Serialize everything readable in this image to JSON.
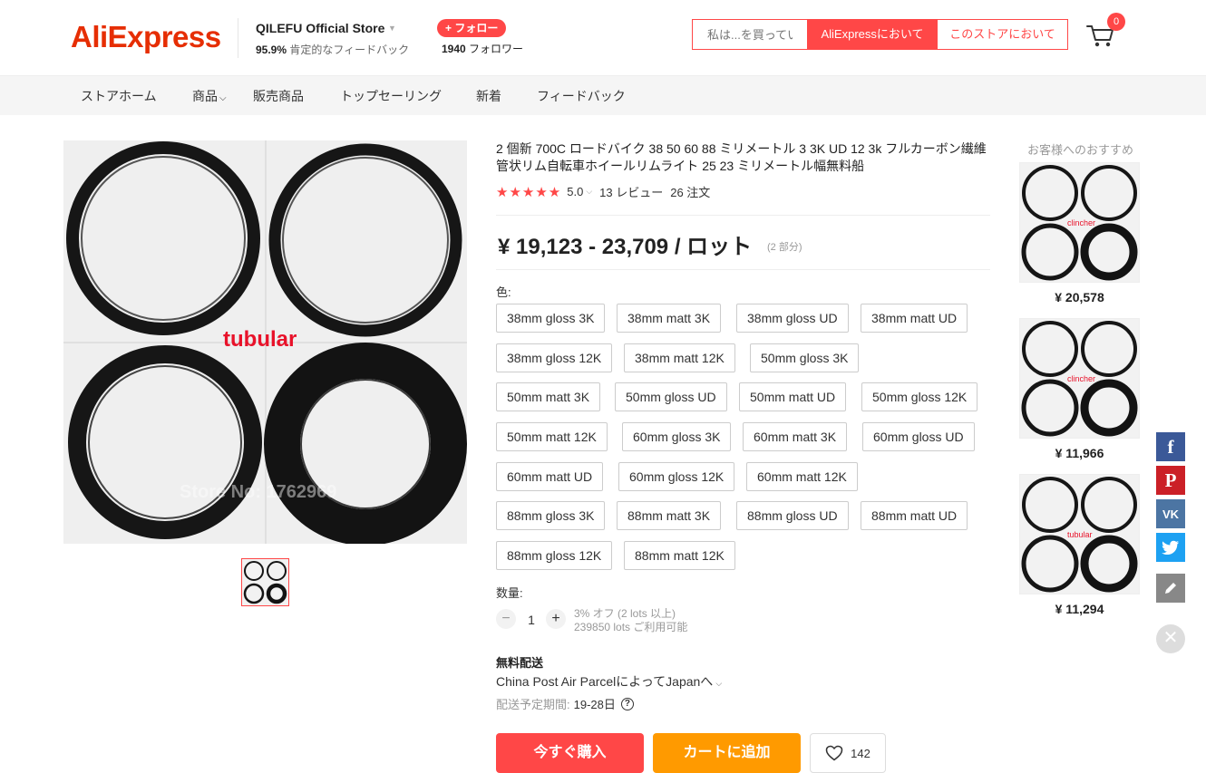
{
  "header": {
    "logo": "AliExpress",
    "store_name": "QILEFU Official Store",
    "feedback_pct": "95.9%",
    "feedback_label": "肯定的なフィードバック",
    "follow_label": "+ フォロー",
    "followers_count": "1940",
    "followers_label": "フォロワー",
    "search_placeholder": "私は...を買ってい",
    "search_ali_label": "AliExpressにおいて",
    "search_store_label": "このストアにおいて",
    "cart_count": "0"
  },
  "nav": [
    "ストアホーム",
    "商品",
    "販売商品",
    "トップセーリング",
    "新着",
    "フィードバック"
  ],
  "gallery": {
    "main_label": "tubular",
    "watermark": "Store No: 1762969"
  },
  "product": {
    "title": "2 個新 700C ロードバイク 38 50 60 88 ミリメートル 3 3K UD 12 3k フルカーボン繊維管状リム自転車ホイールリムライト 25 23 ミリメートル幅無料船",
    "rating": "5.0",
    "reviews": "13 レビュー",
    "orders": "26 注文",
    "price": "¥ 19,123 - 23,709 / ロット",
    "price_note": "(2 部分)",
    "color_label": "色:",
    "color_options": [
      "38mm gloss 3K",
      "38mm matt 3K",
      "38mm gloss UD",
      "38mm matt UD",
      "38mm gloss 12K",
      "38mm matt 12K",
      "50mm gloss 3K",
      "50mm matt 3K",
      "50mm gloss UD",
      "50mm matt UD",
      "50mm gloss 12K",
      "50mm matt 12K",
      "60mm gloss 3K",
      "60mm matt 3K",
      "60mm gloss UD",
      "60mm matt UD",
      "60mm gloss 12K",
      "60mm matt 12K",
      "88mm gloss 3K",
      "88mm matt 3K",
      "88mm gloss UD",
      "88mm matt UD",
      "88mm gloss 12K",
      "88mm matt 12K"
    ],
    "quantity_label": "数量:",
    "quantity": "1",
    "discount_note": "3% オフ (2 lots 以上)",
    "available_note": "239850 lots ご利用可能",
    "shipping_title": "無料配送",
    "shipping_method": "China Post Air ParcelによってJapanへ",
    "eta_label": "配送予定期間:",
    "eta_value": "19-28日",
    "buy_now": "今すぐ購入",
    "add_to_cart": "カートに追加",
    "wishlist_count": "142"
  },
  "recommendations": {
    "title": "お客様へのおすすめ",
    "items": [
      {
        "label": "clincher",
        "price": "¥ 20,578"
      },
      {
        "label": "clincher",
        "price": "¥ 11,966"
      },
      {
        "label": "tubular",
        "price": "¥ 11,294"
      }
    ]
  },
  "share": {
    "colors": {
      "facebook": "#3b5998",
      "pinterest": "#cb2027",
      "vk": "#4c75a3",
      "twitter": "#1da1f2",
      "edit": "#888888"
    }
  },
  "colors": {
    "accent": "#ff4747",
    "cart": "#ff9a00",
    "brand": "#e62e04"
  }
}
